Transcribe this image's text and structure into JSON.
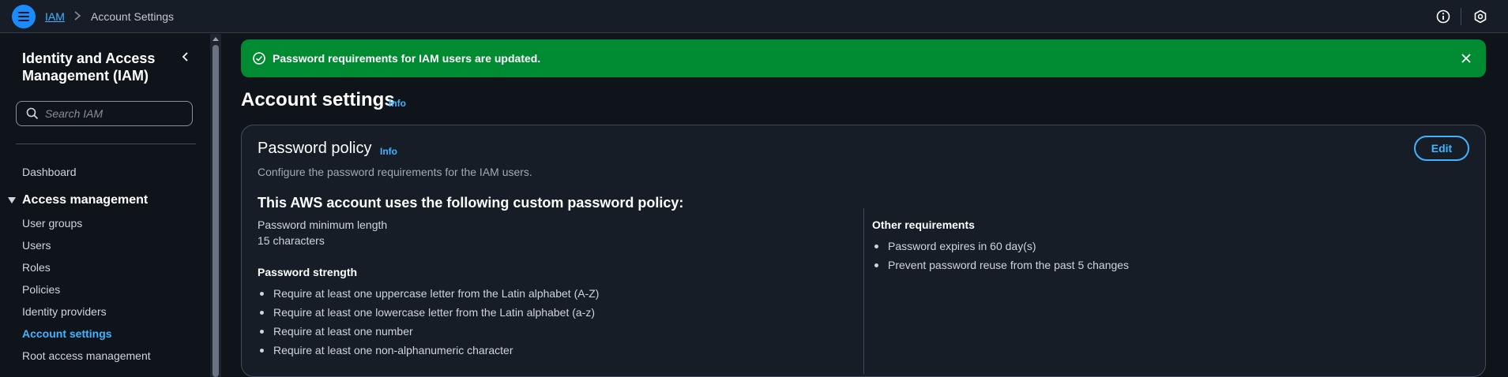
{
  "breadcrumb": {
    "root": "IAM",
    "current": "Account Settings"
  },
  "sidebar": {
    "title": "Identity and Access Management (IAM)",
    "search_placeholder": "Search IAM",
    "dashboard": "Dashboard",
    "section": "Access management",
    "items": [
      {
        "label": "User groups"
      },
      {
        "label": "Users"
      },
      {
        "label": "Roles"
      },
      {
        "label": "Policies"
      },
      {
        "label": "Identity providers"
      },
      {
        "label": "Account settings",
        "active": true
      },
      {
        "label": "Root access management"
      }
    ]
  },
  "flash": {
    "message": "Password requirements for IAM users are updated.",
    "color": "#008a32"
  },
  "page": {
    "title": "Account settings",
    "info": "Info"
  },
  "panel": {
    "title": "Password policy",
    "info": "Info",
    "description": "Configure the password requirements for the IAM users.",
    "edit_label": "Edit",
    "heading": "This AWS account uses the following custom password policy:",
    "min_length_label": "Password minimum length",
    "min_length_value": "15 characters",
    "strength_label": "Password strength",
    "strength_items": [
      "Require at least one uppercase letter from the Latin alphabet (A-Z)",
      "Require at least one lowercase letter from the Latin alphabet (a-z)",
      "Require at least one number",
      "Require at least one non-alphanumeric character"
    ],
    "other_label": "Other requirements",
    "other_items": [
      "Password expires in 60 day(s)",
      "Prevent password reuse from the past 5 changes"
    ]
  },
  "icons": {
    "menu": "menu-icon",
    "info": "info-icon",
    "settings": "settings-hex-icon",
    "success": "check-circle-icon",
    "close": "close-icon",
    "search": "search-icon",
    "collapse": "chevron-left-icon"
  },
  "colors": {
    "accent": "#42b4ff",
    "success": "#008a32",
    "background": "#0f141a",
    "panel": "#161d26"
  }
}
